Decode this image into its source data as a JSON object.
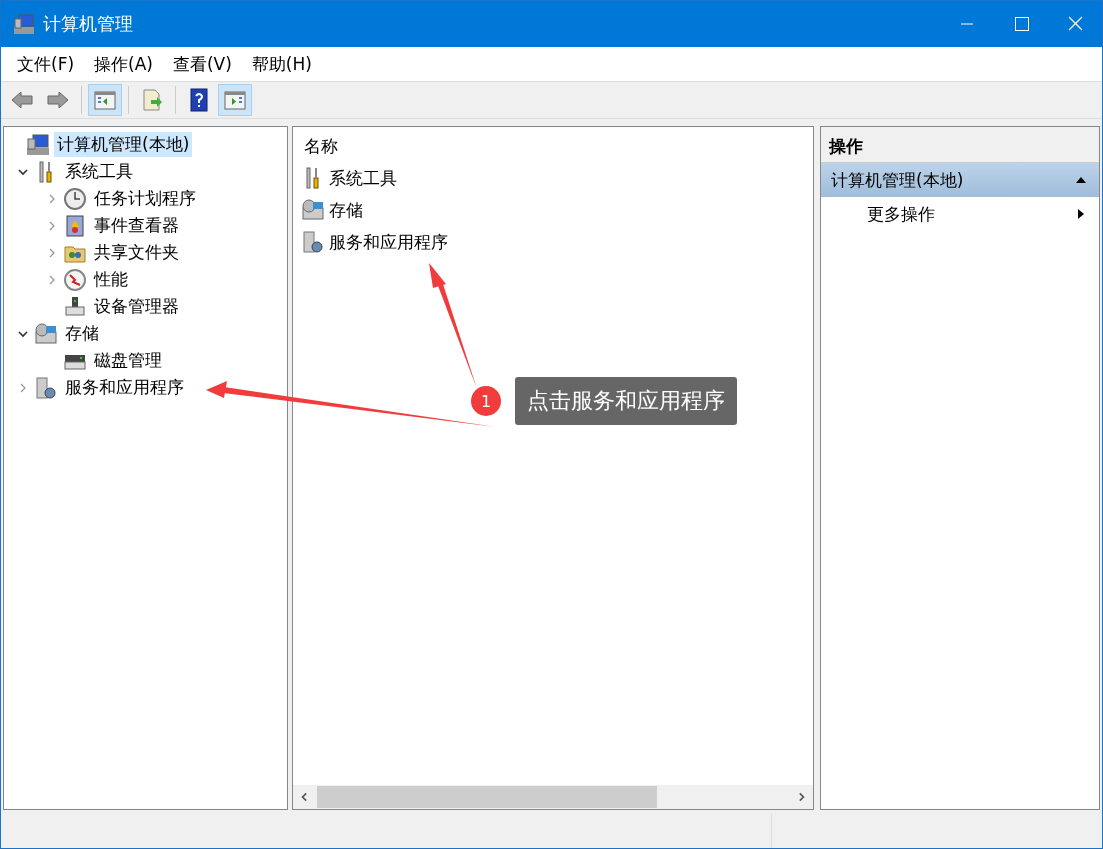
{
  "window": {
    "title": "计算机管理"
  },
  "menu": [
    "文件(F)",
    "操作(A)",
    "查看(V)",
    "帮助(H)"
  ],
  "toolbar": [
    {
      "kind": "back",
      "disabled": true
    },
    {
      "kind": "forward",
      "disabled": true
    },
    {
      "kind": "tree-toggle",
      "pressed": true
    },
    {
      "kind": "export",
      "pressed": false
    },
    {
      "kind": "help",
      "pressed": false
    },
    {
      "kind": "action-toggle",
      "pressed": true
    }
  ],
  "tree": [
    {
      "label": "计算机管理(本地)",
      "kind": "root",
      "selected": true,
      "children": [
        {
          "label": "系统工具",
          "kind": "branch",
          "expanded": true,
          "selected": false,
          "children": [
            {
              "label": "任务计划程序",
              "kind": "branch",
              "expanded": false,
              "selected": false
            },
            {
              "label": "事件查看器",
              "kind": "branch",
              "expanded": false,
              "selected": false
            },
            {
              "label": "共享文件夹",
              "kind": "branch",
              "expanded": false,
              "selected": false
            },
            {
              "label": "性能",
              "kind": "branch",
              "expanded": false,
              "selected": false
            },
            {
              "label": "设备管理器",
              "kind": "leaf",
              "selected": false
            }
          ]
        },
        {
          "label": "存储",
          "kind": "branch",
          "expanded": true,
          "selected": false,
          "children": [
            {
              "label": "磁盘管理",
              "kind": "leaf",
              "selected": false
            }
          ]
        },
        {
          "label": "服务和应用程序",
          "kind": "branch",
          "expanded": false,
          "selected": false
        }
      ]
    }
  ],
  "list": {
    "column": "名称",
    "items": [
      "系统工具",
      "存储",
      "服务和应用程序"
    ]
  },
  "actions": {
    "title": "操作",
    "group": {
      "label": "计算机管理(本地)",
      "expanded": true
    },
    "items": [
      "更多操作"
    ]
  },
  "callout": {
    "number": "1",
    "text": "点击服务和应用程序"
  }
}
